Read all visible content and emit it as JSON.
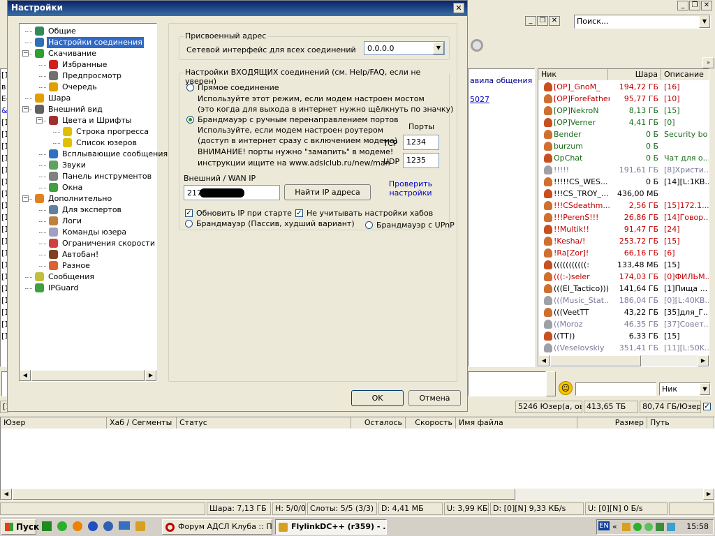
{
  "dialog": {
    "title": "Настройки",
    "ok_label": "OK",
    "cancel_label": "Отмена",
    "tree": [
      {
        "label": "Общие",
        "level": 1
      },
      {
        "label": "Настройки соединения",
        "level": 1,
        "selected": true
      },
      {
        "label": "Скачивание",
        "level": 1,
        "expanded": true
      },
      {
        "label": "Избранные",
        "level": 2
      },
      {
        "label": "Предпросмотр",
        "level": 2
      },
      {
        "label": "Очередь",
        "level": 2
      },
      {
        "label": "Шара",
        "level": 1
      },
      {
        "label": "Внешний вид",
        "level": 1,
        "expanded": true
      },
      {
        "label": "Цвета и Шрифты",
        "level": 2,
        "expanded": true
      },
      {
        "label": "Строка прогресса",
        "level": 3
      },
      {
        "label": "Список юзеров",
        "level": 3
      },
      {
        "label": "Всплывающие сообщения",
        "level": 2
      },
      {
        "label": "Звуки",
        "level": 2
      },
      {
        "label": "Панель инструментов",
        "level": 2
      },
      {
        "label": "Окна",
        "level": 2
      },
      {
        "label": "Дополнительно",
        "level": 1,
        "expanded": true
      },
      {
        "label": "Для экспертов",
        "level": 2
      },
      {
        "label": "Логи",
        "level": 2
      },
      {
        "label": "Команды юзера",
        "level": 2
      },
      {
        "label": "Ограничения скорости",
        "level": 2
      },
      {
        "label": "Автобан!",
        "level": 2
      },
      {
        "label": "Разное",
        "level": 2
      },
      {
        "label": "Сообщения",
        "level": 1
      },
      {
        "label": "IPGuard",
        "level": 1
      }
    ],
    "assigned": {
      "title": "Присвоенный адрес",
      "iface_label": "Сетевой интерфейс для всех соединений",
      "iface_value": "0.0.0.0"
    },
    "incoming": {
      "title": "Настройки ВХОДЯЩИХ соединений (см. Help/FAQ, если не уверен)",
      "direct_label": "Прямое соединение",
      "direct_desc1": "Используйте этот режим, если модем настроен мостом",
      "direct_desc2": "(это когда для выхода в интернет нужно щёлкнуть по значку)",
      "firewall_label": "Брандмауэр с ручным перенаправлением портов",
      "firewall_desc1": "Используйте, если модем настроен роутером",
      "firewall_desc2": "(доступ в интернет сразу с включением модема)",
      "firewall_desc3": "ВНИМАНИЕ! порты нужно \"замапить\" в модеме!",
      "firewall_desc4": "инструкции ищите на www.adslclub.ru/new/man",
      "ports_label": "Порты",
      "tcp_label": "TCP",
      "tcp_value": "1234",
      "udp_label": "UDP",
      "udp_value": "1235",
      "wan_label": "Внешний / WAN IP",
      "wan_value": "217",
      "find_ip_label": "Найти IP адреса",
      "check_link": "Проверить настройки",
      "update_ip_label": "Обновить IP при старте",
      "ignore_hubs_label": "Не учитывать настройки хабов",
      "passive_label": "Брандмауэр (Пассив, худший вариант)",
      "upnp_label": "Брандмауэр с UPnP"
    }
  },
  "main": {
    "search_placeholder": "Поиск...",
    "chat_fragment1": "авила общения",
    "chat_fragment2": "5027",
    "userlist_headers": [
      "Ник",
      "Шара",
      "Описание"
    ],
    "users": [
      {
        "nick": "[OP]_GnoM_",
        "share": "194,72 ГБ",
        "desc": "[16]",
        "color": "#c00000"
      },
      {
        "nick": "[OP]ForeFather",
        "share": "95,77 ГБ",
        "desc": "[10]",
        "color": "#c00000"
      },
      {
        "nick": "[OP]NekroN",
        "share": "8,13 ГБ",
        "desc": "[15]",
        "color": "#1a6b1a"
      },
      {
        "nick": "[OP]Verner",
        "share": "4,41 ГБ",
        "desc": "[0]",
        "color": "#1a6b1a"
      },
      {
        "nick": "Bender",
        "share": "0 Б",
        "desc": "Security bo",
        "color": "#1a6b1a"
      },
      {
        "nick": "burzum",
        "share": "0 Б",
        "desc": "",
        "color": "#1a6b1a"
      },
      {
        "nick": "OpChat",
        "share": "0 Б",
        "desc": "Чат для о...",
        "color": "#1a6b1a"
      },
      {
        "nick": "!!!!!",
        "share": "191,61 ГБ",
        "desc": "[8]Христи...",
        "color": "#7a7a9a"
      },
      {
        "nick": "!!!!!CS_WES...",
        "share": "0 Б",
        "desc": "[14][L:1KB...",
        "color": "#000000"
      },
      {
        "nick": "!!!CS_TROY_...",
        "share": "436,00 МБ",
        "desc": "",
        "color": "#000000"
      },
      {
        "nick": "!!!CSdeathm...",
        "share": "2,56 ГБ",
        "desc": "[15]172.1...",
        "color": "#c00000"
      },
      {
        "nick": "!!!PerenS!!!",
        "share": "26,86 ГБ",
        "desc": "[14]Говор...",
        "color": "#c00000"
      },
      {
        "nick": "!!Multik!!",
        "share": "91,47 ГБ",
        "desc": "[24]",
        "color": "#c00000"
      },
      {
        "nick": "!Kesha/!",
        "share": "253,72 ГБ",
        "desc": "[15]",
        "color": "#c00000"
      },
      {
        "nick": "!Ra[Zor]!",
        "share": "66,16 ГБ",
        "desc": "[6]",
        "color": "#c00000"
      },
      {
        "nick": "(((((((((((:",
        "share": "133,48 МБ",
        "desc": "[15]",
        "color": "#000000"
      },
      {
        "nick": "(((:-)seler",
        "share": "174,03 ГБ",
        "desc": "[0]ФИЛЬМ...",
        "color": "#c00000"
      },
      {
        "nick": "(((El_Tactico)))",
        "share": "141,64 ГБ",
        "desc": "[1]Пища ...",
        "color": "#000000"
      },
      {
        "nick": "(((Music_Stat...",
        "share": "186,04 ГБ",
        "desc": "[0][L:40KB...",
        "color": "#7a7a9a"
      },
      {
        "nick": "(((VeetTT",
        "share": "43,22 ГБ",
        "desc": "[35]для_Г...",
        "color": "#000000"
      },
      {
        "nick": "((Moroz",
        "share": "46,35 ГБ",
        "desc": "[37]Совет...",
        "color": "#7a7a9a"
      },
      {
        "nick": "((TT))",
        "share": "6,33 ГБ",
        "desc": "[15]",
        "color": "#000000"
      },
      {
        "nick": "((Veselovskiy",
        "share": "351,41 ГБ",
        "desc": "[11][L:50K...",
        "color": "#7a7a9a"
      }
    ],
    "nick_select": "Ник",
    "hub_status": {
      "users": "5246 Юзер(а, ов)",
      "share": "413,65 ТБ",
      "per_user": "80,74 ГБ/Юзер"
    },
    "transfer_headers": [
      "Юзер",
      "Хаб / Сегменты",
      "Статус",
      "Осталось",
      "Скорость",
      "Имя файла",
      "Размер",
      "Путь"
    ],
    "status": {
      "share": "Шара: 7,13 ГБ",
      "hubs": "H: 5/0/0",
      "slots": "Слоты: 5/5 (3/3)",
      "down": "D: 4,41 МБ",
      "up": "U: 3,99 КБ",
      "down_speed": "D: [0][N] 9,33 КБ/s",
      "up_speed": "U: [0][N] 0 Б/s"
    },
    "left_fragments": [
      "[1",
      "в",
      "Ес",
      "&",
      "[1",
      "[1",
      "[1",
      "[1",
      "[1",
      "[1",
      "[1",
      "[1",
      "[1",
      "[1",
      "[1",
      "[1",
      "[1",
      "[1",
      "[1",
      "[1",
      "[1",
      "[1",
      "[1"
    ]
  },
  "taskbar": {
    "start_label": "Пуск",
    "tasks": [
      "Форум АДСЛ Клуба :: П...",
      "FlylinkDC++ (r359) - ..."
    ],
    "lang": "EN",
    "clock": "15:58"
  }
}
